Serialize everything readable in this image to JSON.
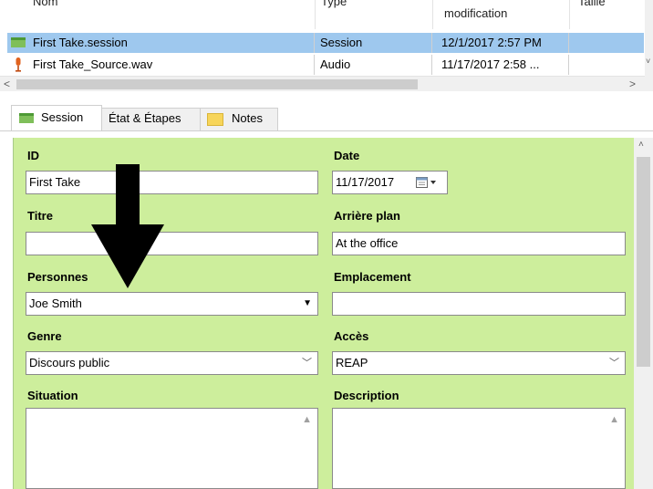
{
  "file_list": {
    "columns": {
      "name": "Nom",
      "type": "Type",
      "modified": "modification",
      "size": "Taille"
    },
    "rows": [
      {
        "name": "First Take.session",
        "type": "Session",
        "modified": "12/1/2017 2:57 PM",
        "icon": "session-icon",
        "selected": true
      },
      {
        "name": "First Take_Source.wav",
        "type": "Audio",
        "modified": "11/17/2017 2:58 ...",
        "icon": "microphone-icon",
        "selected": false
      }
    ]
  },
  "tabs": [
    {
      "label": "Session",
      "icon": "session-icon",
      "active": true
    },
    {
      "label": "État & Étapes",
      "active": false
    },
    {
      "label": "Notes",
      "icon": "notes-icon",
      "active": false
    }
  ],
  "form": {
    "id": {
      "label": "ID",
      "value": "First Take"
    },
    "date": {
      "label": "Date",
      "value": "11/17/2017"
    },
    "title": {
      "label": "Titre",
      "value": ""
    },
    "background": {
      "label": "Arrière plan",
      "value": "At the office"
    },
    "people": {
      "label": "Personnes",
      "value": "Joe Smith"
    },
    "location": {
      "label": "Emplacement",
      "value": ""
    },
    "genre": {
      "label": "Genre",
      "value": "Discours public"
    },
    "access": {
      "label": "Accès",
      "value": "REAP"
    },
    "situation": {
      "label": "Situation",
      "value": ""
    },
    "description": {
      "label": "Description",
      "value": ""
    }
  },
  "colors": {
    "panel_bg": "#cdee9c",
    "selection": "#9ec8ee"
  }
}
